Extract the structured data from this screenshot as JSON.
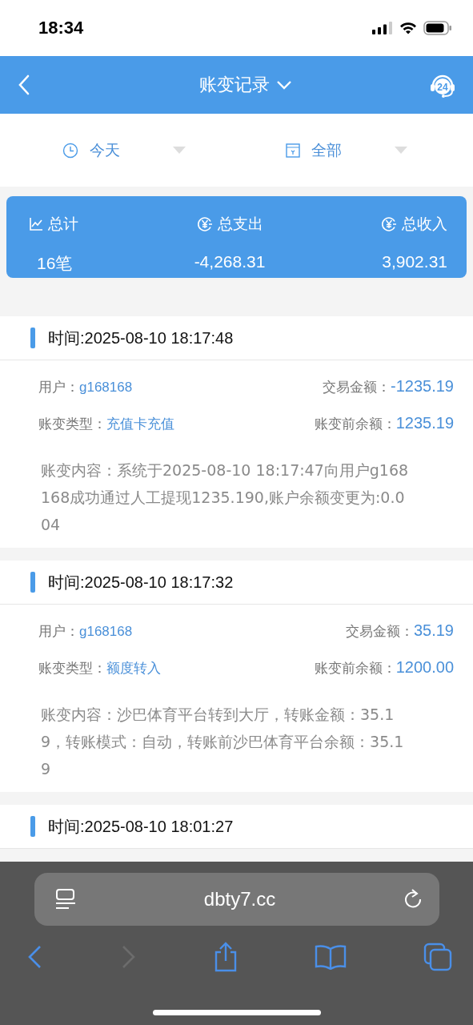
{
  "status_bar": {
    "time": "18:34"
  },
  "header": {
    "title": "账变记录",
    "support_badge": "24"
  },
  "filters": [
    {
      "kind": "time",
      "label": "今天"
    },
    {
      "kind": "type",
      "label": "全部"
    }
  ],
  "summary": [
    {
      "kind": "chart",
      "label": "总计",
      "value": "16笔"
    },
    {
      "kind": "money",
      "label": "总支出",
      "value": "-4,268.31"
    },
    {
      "kind": "money",
      "label": "总收入",
      "value": "3,902.31"
    }
  ],
  "records": [
    {
      "time": "时间:2025-08-10 18:17:48",
      "user_label": "用户：",
      "user": "g168168",
      "amount_label": "交易金额：",
      "amount": "-1235.19",
      "type_label": "账变类型：",
      "type": "充值卡充值",
      "balance_label": "账变前余额：",
      "balance": "1235.19",
      "content": "账变内容：系统于2025-08-10 18:17:47向用户g168168成功通过人工提现1235.190,账户余额变更为:0.004"
    },
    {
      "time": "时间:2025-08-10 18:17:32",
      "user_label": "用户：",
      "user": "g168168",
      "amount_label": "交易金额：",
      "amount": "35.19",
      "type_label": "账变类型：",
      "type": "额度转入",
      "balance_label": "账变前余额：",
      "balance": "1200.00",
      "content": "账变内容：沙巴体育平台转到大厅，转账金额：35.19，转账模式：自动，转账前沙巴体育平台余额：35.19"
    },
    {
      "time": "时间:2025-08-10 18:01:27"
    }
  ],
  "browser": {
    "url": "dbty7.cc"
  }
}
